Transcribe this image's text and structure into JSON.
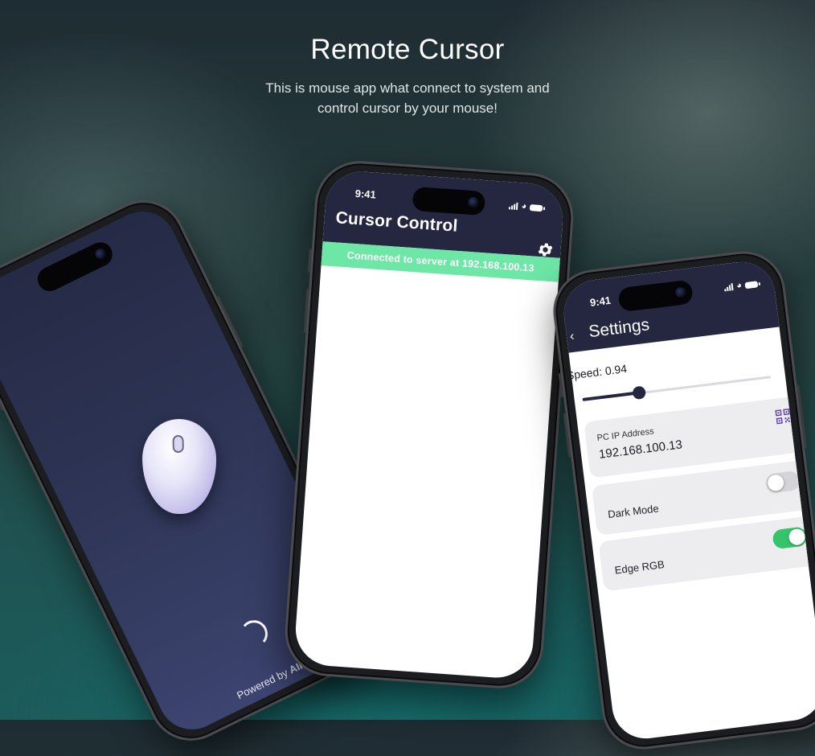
{
  "hero": {
    "title": "Remote Cursor",
    "subtitle": "This is mouse app what connect to system and control cursor by your mouse!"
  },
  "splash_screen": {
    "powered_by_prefix": "Powered by",
    "powered_by_brand": "AIK",
    "icons": [
      "mouse-illustration",
      "loading-spinner"
    ]
  },
  "cursor_control_screen": {
    "status_time": "9:41",
    "title": "Cursor Control",
    "settings_icon": "gear-icon",
    "connection_banner": "Connected to server at 192.168.100.13",
    "colors": {
      "appbar": "#252741",
      "banner": "#6ee6a6"
    }
  },
  "settings_screen": {
    "status_time": "9:41",
    "title": "Settings",
    "speed_label": "Speed: 0.94",
    "speed_value_fraction": 0.3,
    "ip_field": {
      "label": "PC IP Address",
      "value": "192.168.100.13",
      "icon": "qr-scan-icon"
    },
    "toggles": [
      {
        "label": "Dark Mode",
        "on": false
      },
      {
        "label": "Edge RGB",
        "on": true
      }
    ],
    "colors": {
      "header": "#252741",
      "toggle_on": "#35c46a",
      "card": "#ededf0"
    }
  }
}
